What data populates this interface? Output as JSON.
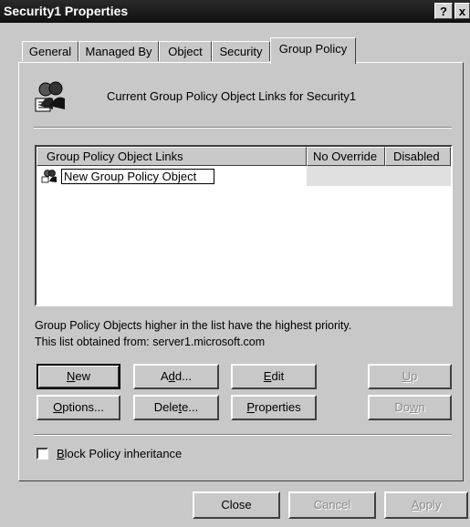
{
  "window": {
    "title": "Security1 Properties",
    "help": "?",
    "close": "x"
  },
  "tabs": [
    {
      "label": "General"
    },
    {
      "label": "Managed By"
    },
    {
      "label": "Object"
    },
    {
      "label": "Security"
    },
    {
      "label": "Group Policy"
    }
  ],
  "active_tab": "Group Policy",
  "header": {
    "text": "Current Group Policy Object Links for Security1",
    "icon": "group-policy-icon"
  },
  "list": {
    "columns": [
      "Group Policy Object Links",
      "No Override",
      "Disabled"
    ],
    "rows": [
      {
        "name": "New Group Policy Object",
        "editing": true,
        "icon": "group-policy-icon"
      }
    ]
  },
  "info": {
    "line1": "Group Policy Objects higher in the list have the highest priority.",
    "line2": "This list obtained from: server1.microsoft.com"
  },
  "buttons": {
    "new_pre": "",
    "new_u": "N",
    "new_post": "ew",
    "add_pre": "A",
    "add_u": "d",
    "add_post": "d...",
    "edit_pre": "",
    "edit_u": "E",
    "edit_post": "dit",
    "up_pre": "",
    "up_u": "U",
    "up_post": "p",
    "options_pre": "",
    "options_u": "O",
    "options_post": "ptions...",
    "delete_pre": "Dele",
    "delete_u": "t",
    "delete_post": "e...",
    "properties_pre": "",
    "properties_u": "P",
    "properties_post": "roperties",
    "down_pre": "Do",
    "down_u": "w",
    "down_post": "n"
  },
  "block": {
    "pre": "",
    "u": "B",
    "post": "lock Policy inheritance",
    "checked": false
  },
  "footer": {
    "close": "Close",
    "cancel": "Cancel",
    "apply_u": "A",
    "apply_post": "pply"
  },
  "colors": {
    "titlebar": "#1a1a1a",
    "face": "#c8c8c8",
    "disabled_text": "#8a8a8a"
  }
}
